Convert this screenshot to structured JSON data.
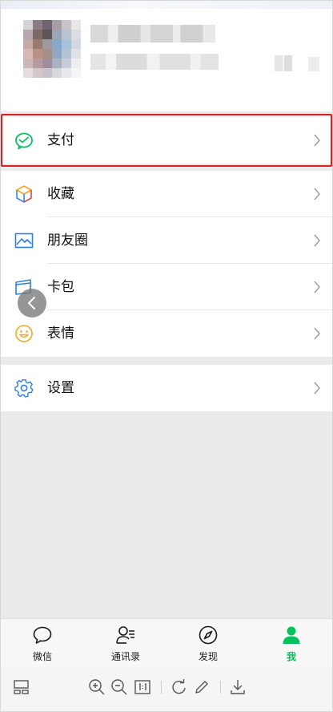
{
  "menu": {
    "pay": {
      "label": "支付",
      "icon": "wechat-pay-icon"
    },
    "favorites": {
      "label": "收藏",
      "icon": "favorites-cube-icon"
    },
    "moments": {
      "label": "朋友圈",
      "icon": "moments-picture-icon"
    },
    "cards": {
      "label": "卡包",
      "icon": "card-wallet-icon"
    },
    "stickers": {
      "label": "表情",
      "icon": "smiley-icon"
    },
    "settings": {
      "label": "设置",
      "icon": "gear-icon"
    }
  },
  "tabbar": {
    "chats": {
      "label": "微信",
      "icon": "chat-bubble-icon"
    },
    "contacts": {
      "label": "通讯录",
      "icon": "contacts-icon"
    },
    "discover": {
      "label": "发现",
      "icon": "compass-icon"
    },
    "me": {
      "label": "我",
      "icon": "person-icon",
      "active": true
    }
  },
  "colors": {
    "accent": "#07c160",
    "highlight": "#e02020",
    "background": "#ebebeb"
  }
}
